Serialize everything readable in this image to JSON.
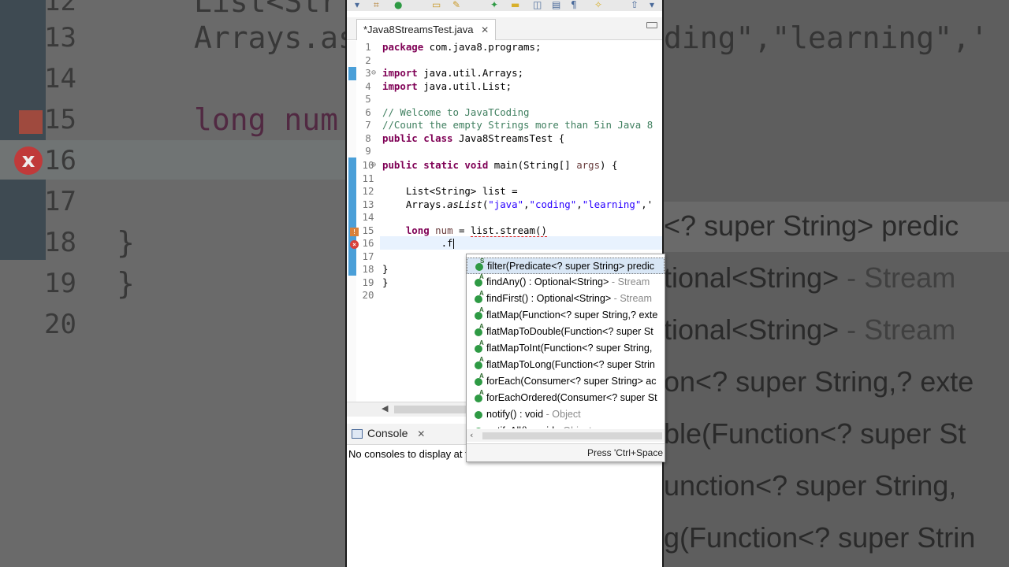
{
  "background": {
    "left_lines": [
      {
        "num": "12",
        "text": "List<Str"
      },
      {
        "num": "13",
        "text": "Arrays.as"
      },
      {
        "num": "14",
        "text": ""
      },
      {
        "num": "15",
        "text": "long num"
      },
      {
        "num": "16",
        "text": ""
      },
      {
        "num": "17",
        "text": ""
      },
      {
        "num": "18",
        "text": "}"
      },
      {
        "num": "19",
        "text": "}"
      },
      {
        "num": "20",
        "text": ""
      }
    ],
    "right_top": "ding\",\"learning\",'",
    "right_items": [
      {
        "main": "<? super String> predic",
        "grey": ""
      },
      {
        "main": "tional<String>",
        "grey": " - Stream"
      },
      {
        "main": "tional<String>",
        "grey": " - Stream"
      },
      {
        "main": "on<? super String,? exte",
        "grey": ""
      },
      {
        "main": "ble(Function<? super St",
        "grey": ""
      },
      {
        "main": "unction<? super String,",
        "grey": ""
      },
      {
        "main": "g(Function<? super Strin",
        "grey": ""
      }
    ]
  },
  "editor": {
    "tab_title": "*Java8StreamsTest.java",
    "line_numbers": [
      "1",
      "2",
      "3",
      "4",
      "5",
      "6",
      "7",
      "8",
      "9",
      "10",
      "11",
      "12",
      "13",
      "14",
      "15",
      "16",
      "17",
      "18",
      "19",
      "20"
    ]
  },
  "code": {
    "l1_kw": "package",
    "l1_rest": " com.java8.programs;",
    "l3_kw": "import",
    "l3_rest": " java.util.Arrays;",
    "l4_kw": "import",
    "l4_rest": " java.util.List;",
    "l6": "// Welcome to JavaTCoding",
    "l7": "//Count the empty Strings more than 5in Java 8",
    "l8_kw": "public class",
    "l8_rest": " Java8StreamsTest {",
    "l10_kw": "public static void",
    "l10_rest": " main(String[] ",
    "l10_var": "args",
    "l10_end": ") {",
    "l12": "    List<String> list =",
    "l13_a": "    Arrays.",
    "l13_b": "asList",
    "l13_c": "(",
    "l13_s1": "\"java\"",
    "l13_s2": "\"coding\"",
    "l13_s3": "\"learning\"",
    "l13_tail": ",'",
    "l15_kw": "    long",
    "l15_a": " num",
    "l15_b": " = ",
    "l15_c": "list.stream()",
    "l16": "          .f",
    "l18": "}",
    "l19": "}"
  },
  "content_assist": {
    "items": [
      {
        "main": "filter(Predicate<? super String> predic",
        "grey": ""
      },
      {
        "main": "findAny() : Optional<String>",
        "grey": " - Stream"
      },
      {
        "main": "findFirst() : Optional<String>",
        "grey": " - Stream"
      },
      {
        "main": "flatMap(Function<? super String,? exte",
        "grey": ""
      },
      {
        "main": "flatMapToDouble(Function<? super St",
        "grey": ""
      },
      {
        "main": "flatMapToInt(Function<? super String,",
        "grey": ""
      },
      {
        "main": "flatMapToLong(Function<? super Strin",
        "grey": ""
      },
      {
        "main": "forEach(Consumer<? super String> ac",
        "grey": ""
      },
      {
        "main": "forEachOrdered(Consumer<? super St",
        "grey": ""
      },
      {
        "main": "notify() : void",
        "grey": " - Object"
      },
      {
        "main": "notifyAll() : void",
        "grey": " - Object"
      }
    ],
    "status": "Press 'Ctrl+Space"
  },
  "console": {
    "tab_label": "Console",
    "message": "No consoles to display at t"
  }
}
